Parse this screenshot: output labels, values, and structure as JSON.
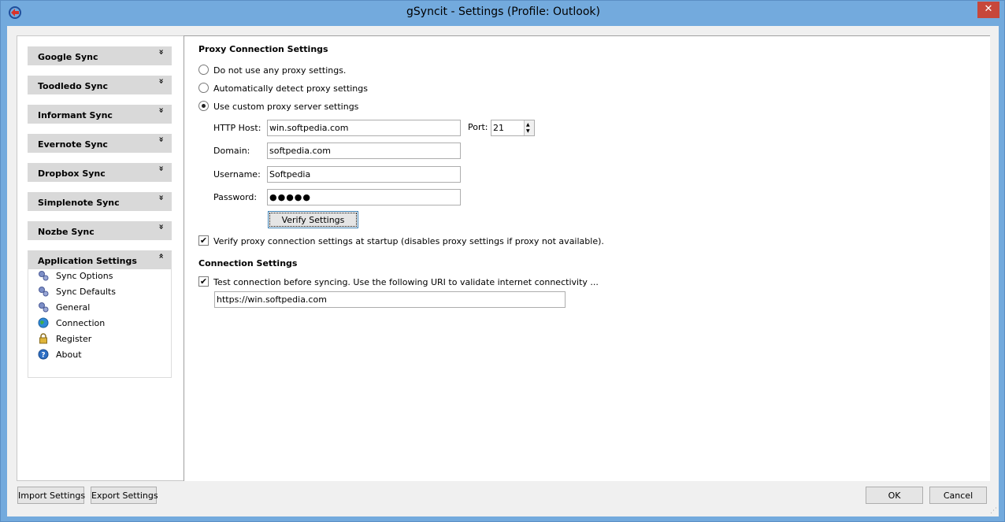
{
  "window": {
    "title": "gSyncit - Settings (Profile: Outlook)",
    "close_glyph": "✕",
    "accent": "#73aadd"
  },
  "sidebar": {
    "sections": [
      {
        "label": "Google Sync",
        "chevron": "»"
      },
      {
        "label": "Toodledo Sync",
        "chevron": "»"
      },
      {
        "label": "Informant Sync",
        "chevron": "»"
      },
      {
        "label": "Evernote Sync",
        "chevron": "»"
      },
      {
        "label": "Dropbox Sync",
        "chevron": "»"
      },
      {
        "label": "Simplenote Sync",
        "chevron": "»"
      },
      {
        "label": "Nozbe Sync",
        "chevron": "»"
      },
      {
        "label": "Application Settings",
        "chevron": "«"
      }
    ],
    "app_items": [
      {
        "label": "Sync Options",
        "icon": "gears-icon"
      },
      {
        "label": "Sync Defaults",
        "icon": "gears-icon"
      },
      {
        "label": "General",
        "icon": "gears-icon"
      },
      {
        "label": "Connection",
        "icon": "globe-icon"
      },
      {
        "label": "Register",
        "icon": "lock-icon"
      },
      {
        "label": "About",
        "icon": "help-icon"
      }
    ]
  },
  "proxy": {
    "title": "Proxy Connection Settings",
    "options": [
      {
        "label": "Do not use any proxy settings.",
        "selected": false
      },
      {
        "label": "Automatically detect proxy settings",
        "selected": false
      },
      {
        "label": "Use custom proxy server settings",
        "selected": true
      }
    ],
    "http_host_label": "HTTP Host:",
    "http_host_value": "win.softpedia.com",
    "port_label": "Port:",
    "port_value": "21",
    "domain_label": "Domain:",
    "domain_value": "softpedia.com",
    "username_label": "Username:",
    "username_value": "Softpedia",
    "password_label": "Password:",
    "password_value": "●●●●●",
    "verify_button": "Verify Settings",
    "verify_startup_label": "Verify proxy connection settings at startup (disables proxy settings if proxy not available).",
    "verify_startup_checked": true
  },
  "connection": {
    "title": "Connection Settings",
    "test_label": "Test connection before syncing. Use the following URI to validate internet connectivity ...",
    "test_checked": true,
    "uri_value": "https://win.softpedia.com"
  },
  "footer": {
    "import_button": "Import Settings",
    "export_button": "Export Settings",
    "ok_button": "OK",
    "cancel_button": "Cancel"
  }
}
